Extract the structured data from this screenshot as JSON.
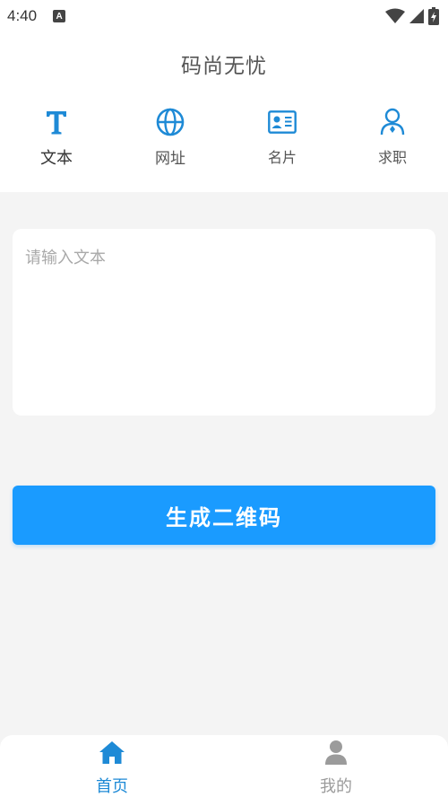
{
  "status_bar": {
    "time": "4:40",
    "notification_glyph": "A"
  },
  "header": {
    "title": "码尚无忧"
  },
  "tabs": [
    {
      "label": "文本",
      "icon": "text-icon",
      "active": true
    },
    {
      "label": "网址",
      "icon": "globe-icon",
      "active": false
    },
    {
      "label": "名片",
      "icon": "business-card-icon",
      "active": false
    },
    {
      "label": "求职",
      "icon": "person-icon",
      "active": false
    }
  ],
  "text_input": {
    "placeholder": "请输入文本",
    "value": ""
  },
  "generate_button": {
    "label": "生成二维码"
  },
  "bottom_nav": [
    {
      "label": "首页",
      "icon": "home-icon",
      "active": true
    },
    {
      "label": "我的",
      "icon": "user-icon",
      "active": false
    }
  ],
  "colors": {
    "accent": "#1a9bff",
    "icon_blue": "#1e8ad6",
    "nav_active": "#1e8ad6",
    "nav_inactive": "#9b9b9b",
    "background": "#f4f4f4"
  }
}
